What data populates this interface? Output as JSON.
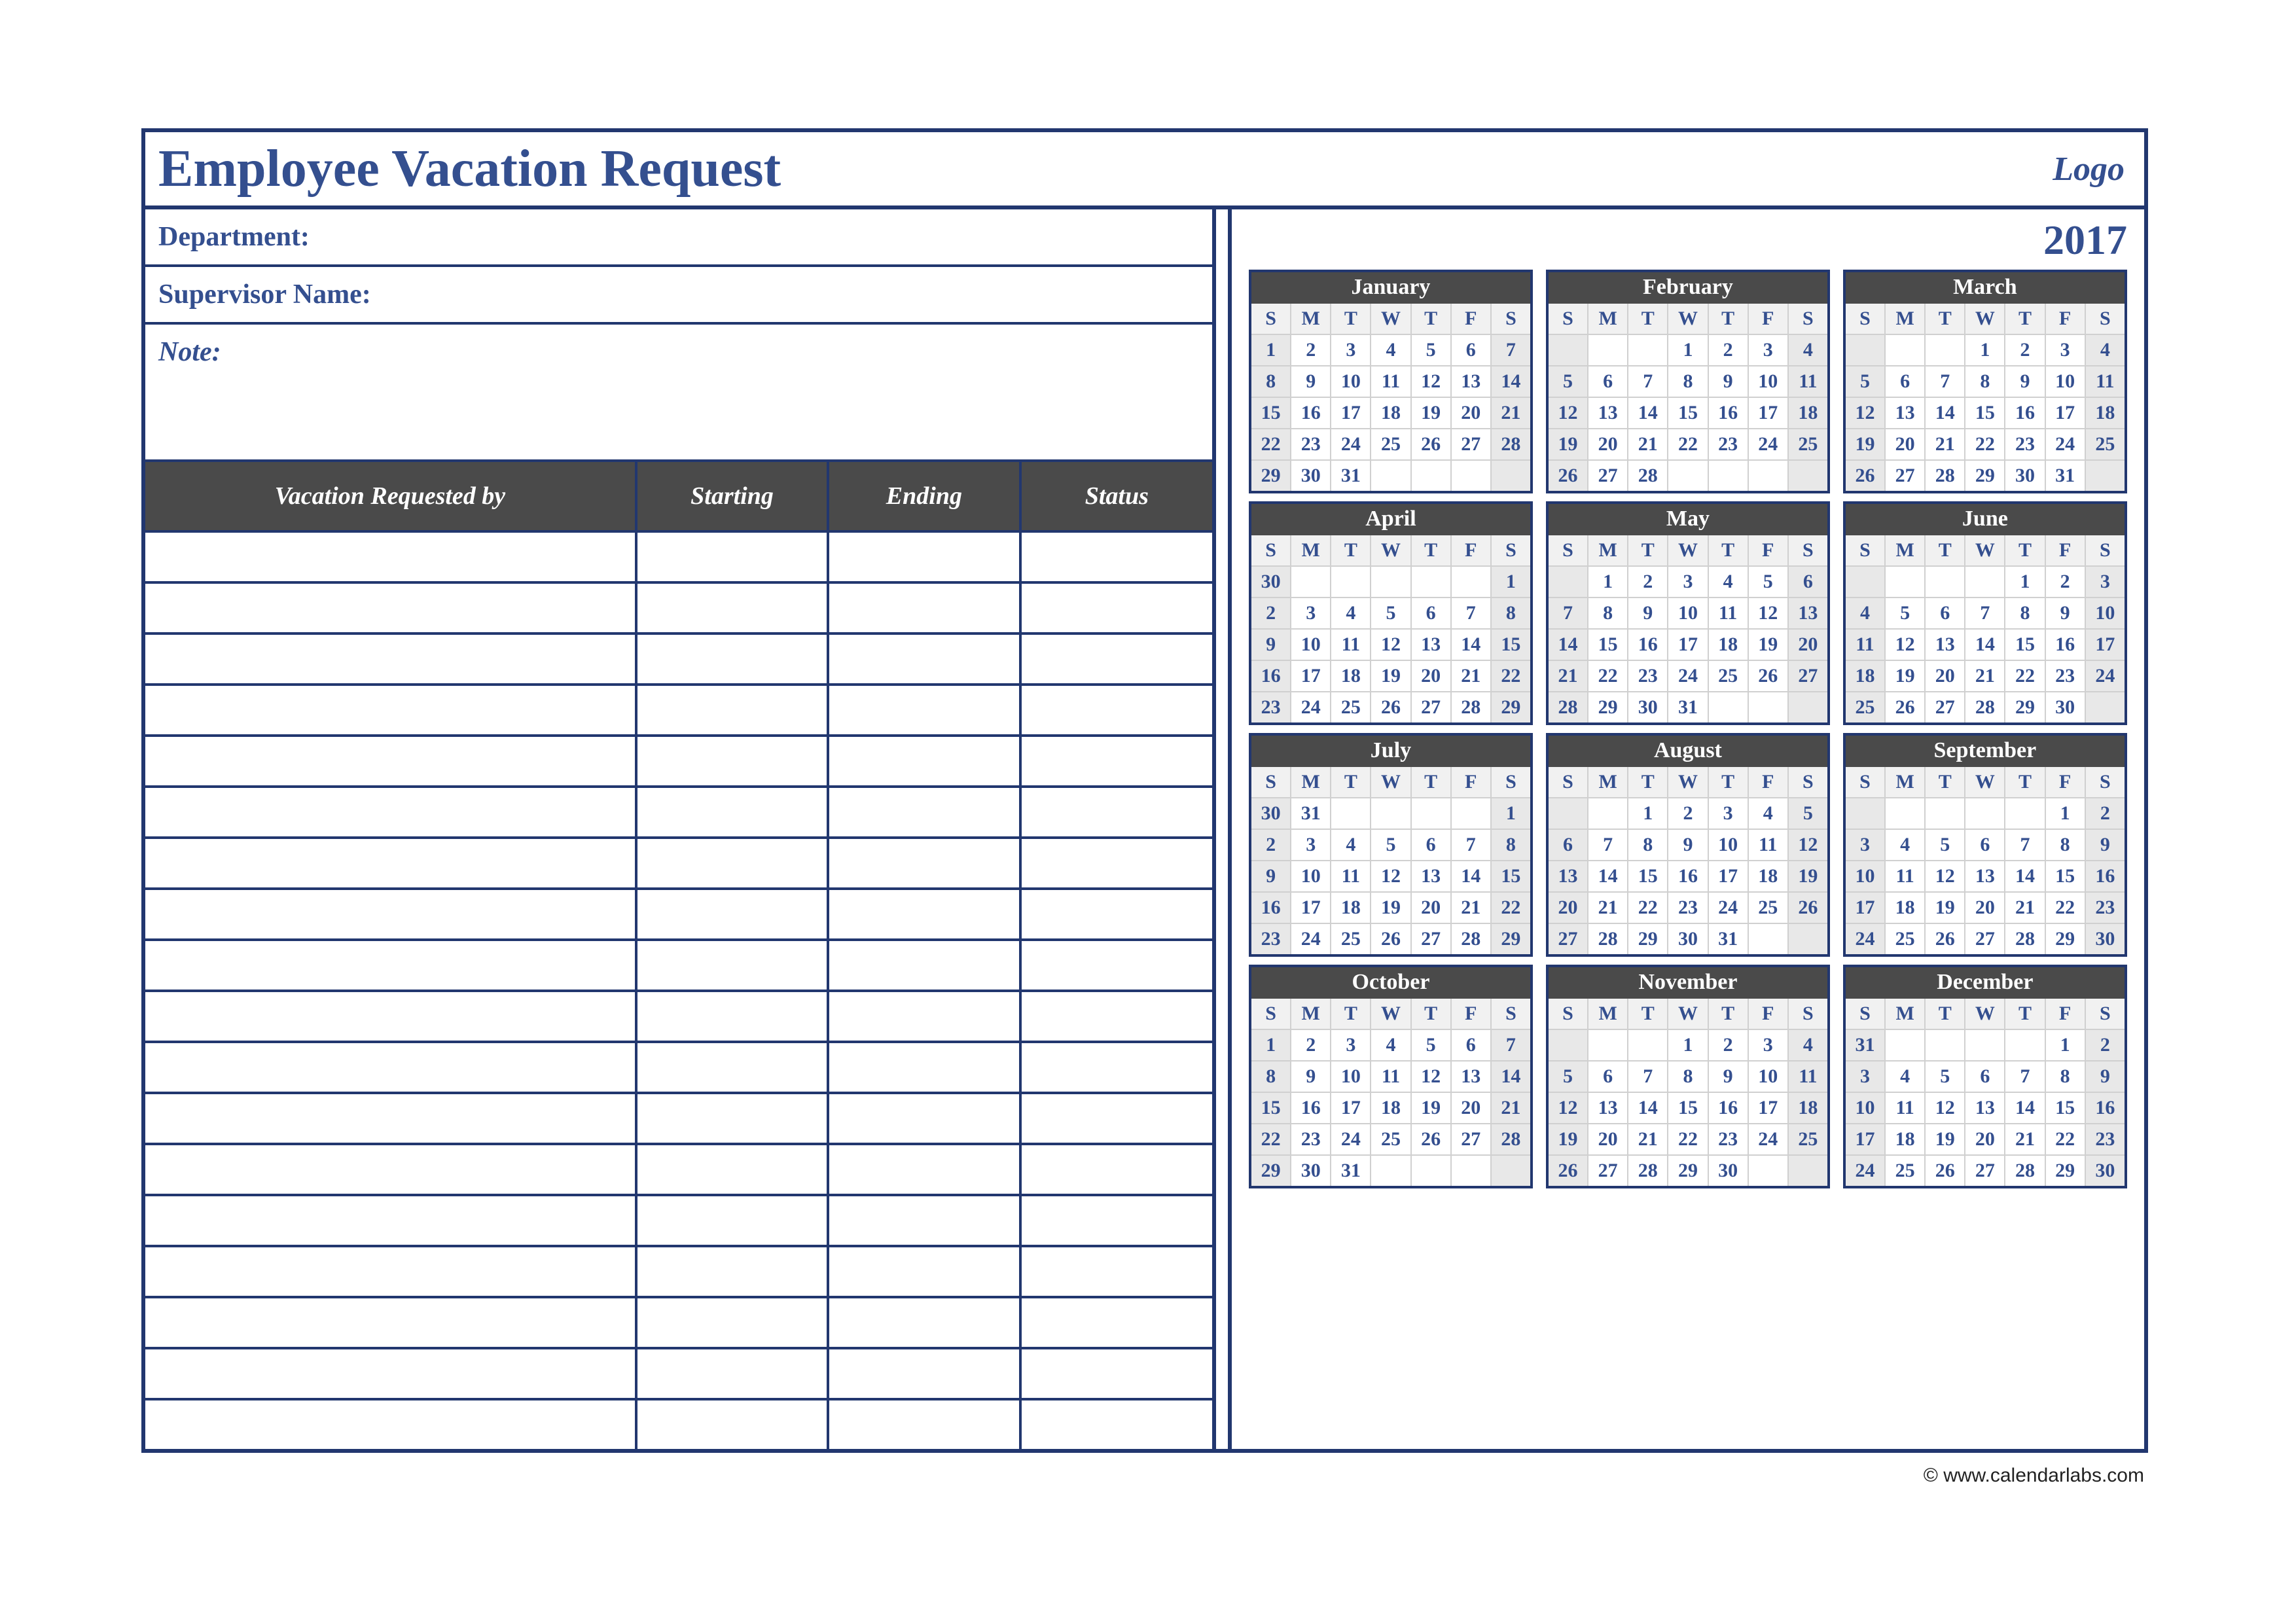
{
  "header": {
    "title": "Employee Vacation Request",
    "logo": "Logo"
  },
  "info": {
    "department_label": "Department:",
    "supervisor_label": "Supervisor Name:",
    "note_label": "Note:"
  },
  "request_table": {
    "headers": [
      "Vacation Requested by",
      "Starting",
      "Ending",
      "Status"
    ],
    "row_count": 18
  },
  "year": "2017",
  "dow": [
    "S",
    "M",
    "T",
    "W",
    "T",
    "F",
    "S"
  ],
  "months": [
    {
      "name": "January",
      "weeks": [
        [
          "1",
          "2",
          "3",
          "4",
          "5",
          "6",
          "7"
        ],
        [
          "8",
          "9",
          "10",
          "11",
          "12",
          "13",
          "14"
        ],
        [
          "15",
          "16",
          "17",
          "18",
          "19",
          "20",
          "21"
        ],
        [
          "22",
          "23",
          "24",
          "25",
          "26",
          "27",
          "28"
        ],
        [
          "29",
          "30",
          "31",
          "",
          "",
          "",
          ""
        ]
      ]
    },
    {
      "name": "February",
      "weeks": [
        [
          "",
          "",
          "",
          "1",
          "2",
          "3",
          "4"
        ],
        [
          "5",
          "6",
          "7",
          "8",
          "9",
          "10",
          "11"
        ],
        [
          "12",
          "13",
          "14",
          "15",
          "16",
          "17",
          "18"
        ],
        [
          "19",
          "20",
          "21",
          "22",
          "23",
          "24",
          "25"
        ],
        [
          "26",
          "27",
          "28",
          "",
          "",
          "",
          ""
        ]
      ]
    },
    {
      "name": "March",
      "weeks": [
        [
          "",
          "",
          "",
          "1",
          "2",
          "3",
          "4"
        ],
        [
          "5",
          "6",
          "7",
          "8",
          "9",
          "10",
          "11"
        ],
        [
          "12",
          "13",
          "14",
          "15",
          "16",
          "17",
          "18"
        ],
        [
          "19",
          "20",
          "21",
          "22",
          "23",
          "24",
          "25"
        ],
        [
          "26",
          "27",
          "28",
          "29",
          "30",
          "31",
          ""
        ]
      ]
    },
    {
      "name": "April",
      "weeks": [
        [
          "30",
          "",
          "",
          "",
          "",
          "",
          "1"
        ],
        [
          "2",
          "3",
          "4",
          "5",
          "6",
          "7",
          "8"
        ],
        [
          "9",
          "10",
          "11",
          "12",
          "13",
          "14",
          "15"
        ],
        [
          "16",
          "17",
          "18",
          "19",
          "20",
          "21",
          "22"
        ],
        [
          "23",
          "24",
          "25",
          "26",
          "27",
          "28",
          "29"
        ]
      ]
    },
    {
      "name": "May",
      "weeks": [
        [
          "",
          "1",
          "2",
          "3",
          "4",
          "5",
          "6"
        ],
        [
          "7",
          "8",
          "9",
          "10",
          "11",
          "12",
          "13"
        ],
        [
          "14",
          "15",
          "16",
          "17",
          "18",
          "19",
          "20"
        ],
        [
          "21",
          "22",
          "23",
          "24",
          "25",
          "26",
          "27"
        ],
        [
          "28",
          "29",
          "30",
          "31",
          "",
          "",
          ""
        ]
      ]
    },
    {
      "name": "June",
      "weeks": [
        [
          "",
          "",
          "",
          "",
          "1",
          "2",
          "3"
        ],
        [
          "4",
          "5",
          "6",
          "7",
          "8",
          "9",
          "10"
        ],
        [
          "11",
          "12",
          "13",
          "14",
          "15",
          "16",
          "17"
        ],
        [
          "18",
          "19",
          "20",
          "21",
          "22",
          "23",
          "24"
        ],
        [
          "25",
          "26",
          "27",
          "28",
          "29",
          "30",
          ""
        ]
      ]
    },
    {
      "name": "July",
      "weeks": [
        [
          "30",
          "31",
          "",
          "",
          "",
          "",
          "1"
        ],
        [
          "2",
          "3",
          "4",
          "5",
          "6",
          "7",
          "8"
        ],
        [
          "9",
          "10",
          "11",
          "12",
          "13",
          "14",
          "15"
        ],
        [
          "16",
          "17",
          "18",
          "19",
          "20",
          "21",
          "22"
        ],
        [
          "23",
          "24",
          "25",
          "26",
          "27",
          "28",
          "29"
        ]
      ]
    },
    {
      "name": "August",
      "weeks": [
        [
          "",
          "",
          "1",
          "2",
          "3",
          "4",
          "5"
        ],
        [
          "6",
          "7",
          "8",
          "9",
          "10",
          "11",
          "12"
        ],
        [
          "13",
          "14",
          "15",
          "16",
          "17",
          "18",
          "19"
        ],
        [
          "20",
          "21",
          "22",
          "23",
          "24",
          "25",
          "26"
        ],
        [
          "27",
          "28",
          "29",
          "30",
          "31",
          "",
          ""
        ]
      ]
    },
    {
      "name": "September",
      "weeks": [
        [
          "",
          "",
          "",
          "",
          "",
          "1",
          "2"
        ],
        [
          "3",
          "4",
          "5",
          "6",
          "7",
          "8",
          "9"
        ],
        [
          "10",
          "11",
          "12",
          "13",
          "14",
          "15",
          "16"
        ],
        [
          "17",
          "18",
          "19",
          "20",
          "21",
          "22",
          "23"
        ],
        [
          "24",
          "25",
          "26",
          "27",
          "28",
          "29",
          "30"
        ]
      ]
    },
    {
      "name": "October",
      "weeks": [
        [
          "1",
          "2",
          "3",
          "4",
          "5",
          "6",
          "7"
        ],
        [
          "8",
          "9",
          "10",
          "11",
          "12",
          "13",
          "14"
        ],
        [
          "15",
          "16",
          "17",
          "18",
          "19",
          "20",
          "21"
        ],
        [
          "22",
          "23",
          "24",
          "25",
          "26",
          "27",
          "28"
        ],
        [
          "29",
          "30",
          "31",
          "",
          "",
          "",
          ""
        ]
      ]
    },
    {
      "name": "November",
      "weeks": [
        [
          "",
          "",
          "",
          "1",
          "2",
          "3",
          "4"
        ],
        [
          "5",
          "6",
          "7",
          "8",
          "9",
          "10",
          "11"
        ],
        [
          "12",
          "13",
          "14",
          "15",
          "16",
          "17",
          "18"
        ],
        [
          "19",
          "20",
          "21",
          "22",
          "23",
          "24",
          "25"
        ],
        [
          "26",
          "27",
          "28",
          "29",
          "30",
          "",
          ""
        ]
      ]
    },
    {
      "name": "December",
      "weeks": [
        [
          "31",
          "",
          "",
          "",
          "",
          "1",
          "2"
        ],
        [
          "3",
          "4",
          "5",
          "6",
          "7",
          "8",
          "9"
        ],
        [
          "10",
          "11",
          "12",
          "13",
          "14",
          "15",
          "16"
        ],
        [
          "17",
          "18",
          "19",
          "20",
          "21",
          "22",
          "23"
        ],
        [
          "24",
          "25",
          "26",
          "27",
          "28",
          "29",
          "30"
        ]
      ]
    }
  ],
  "footer": "© www.calendarlabs.com"
}
